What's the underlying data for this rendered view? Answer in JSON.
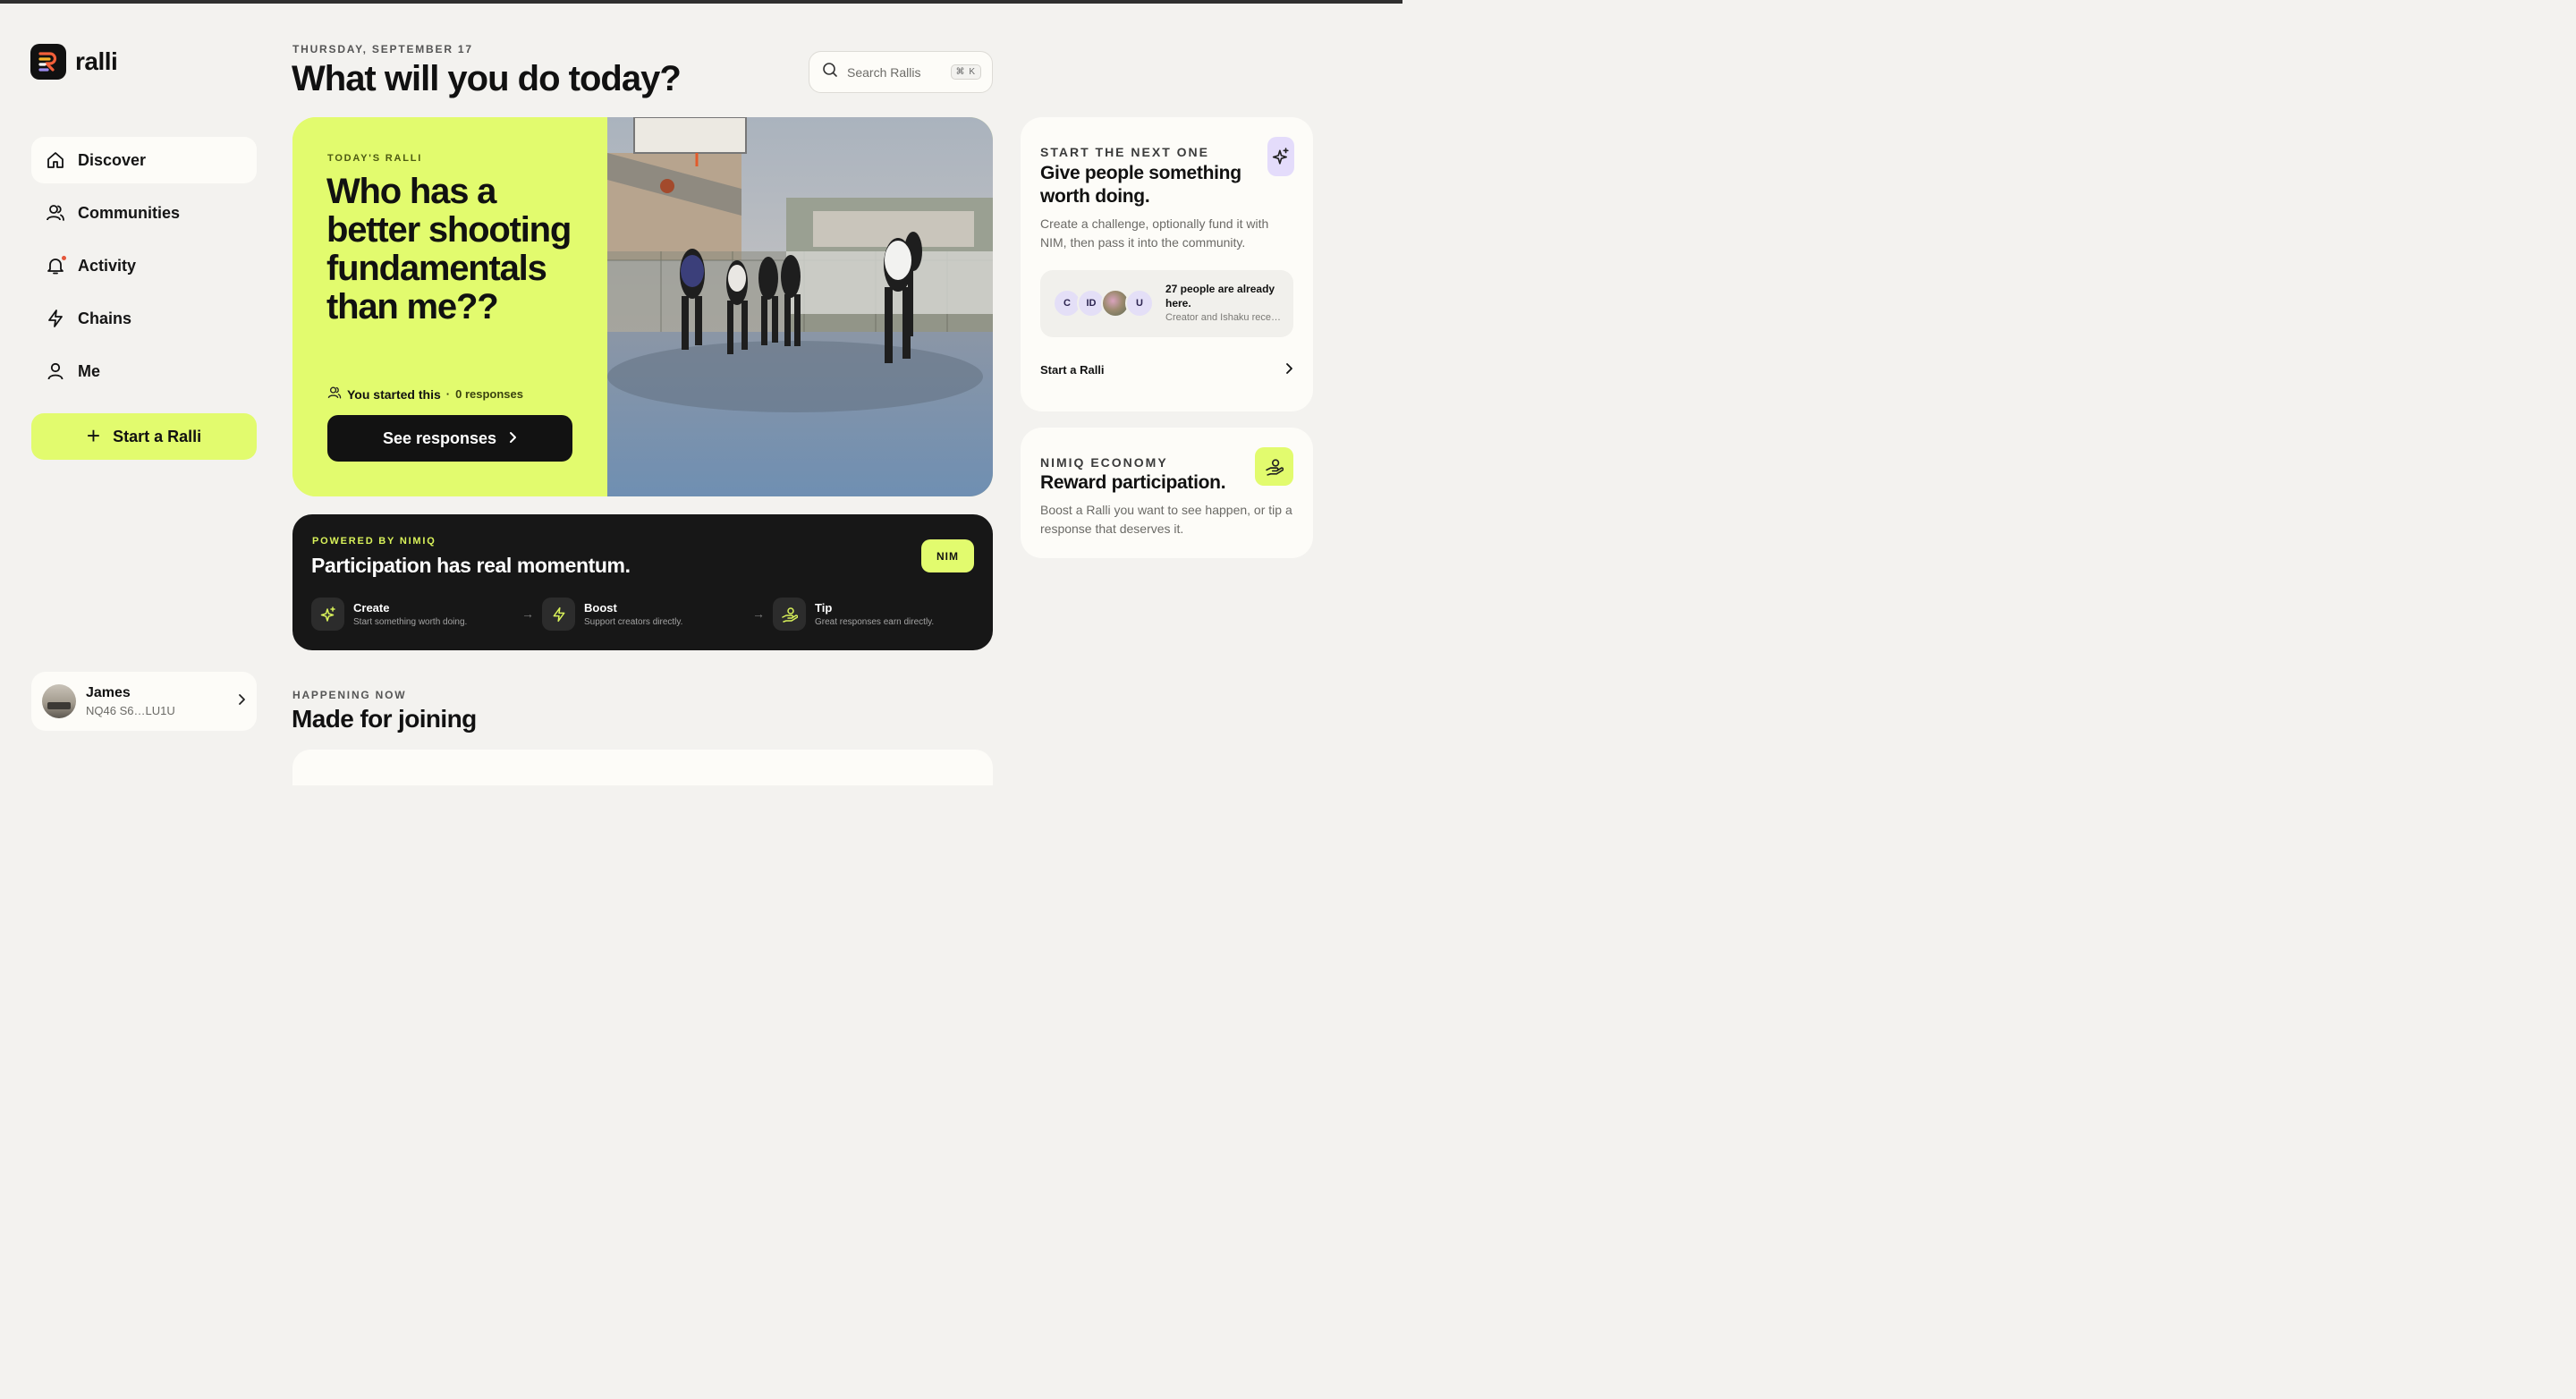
{
  "app": {
    "name": "ralli"
  },
  "sidebar": {
    "items": [
      {
        "label": "Discover",
        "icon": "home-icon",
        "active": true
      },
      {
        "label": "Communities",
        "icon": "users-icon"
      },
      {
        "label": "Activity",
        "icon": "bell-icon"
      },
      {
        "label": "Chains",
        "icon": "bolt-icon"
      },
      {
        "label": "Me",
        "icon": "user-icon"
      }
    ],
    "start_label": "Start a Ralli",
    "user": {
      "name": "James",
      "address": "NQ46 S6…LU1U"
    }
  },
  "header": {
    "date": "THURSDAY, SEPTEMBER 17",
    "headline": "What will you do today?",
    "search": {
      "placeholder": "Search Rallis",
      "shortcut": "⌘ K"
    }
  },
  "hero": {
    "kicker": "TODAY'S RALLI",
    "title": "Who has a better shooting fundamentals than me??",
    "started": "You started this",
    "separator": "·",
    "responses": "0 responses",
    "button": "See responses"
  },
  "nimiq": {
    "kicker": "POWERED BY NIMIQ",
    "title": "Participation has real momentum.",
    "badge": "NIM",
    "steps": [
      {
        "title": "Create",
        "desc": "Start something worth doing.",
        "icon": "sparkle-icon"
      },
      {
        "title": "Boost",
        "desc": "Support creators directly.",
        "icon": "bolt-icon"
      },
      {
        "title": "Tip",
        "desc": "Great responses earn directly.",
        "icon": "tip-hand-icon"
      }
    ]
  },
  "happening": {
    "kicker": "HAPPENING NOW",
    "title": "Made for joining"
  },
  "next_card": {
    "kicker": "START THE NEXT ONE",
    "title": "Give people something worth doing.",
    "desc": "Create a challenge, optionally fund it with NIM, then pass it into the community.",
    "avatars": [
      "C",
      "ID",
      "",
      "U"
    ],
    "people_title": "27 people are already here.",
    "people_sub": "Creator and Ishaku rece…",
    "link": "Start a Ralli"
  },
  "economy_card": {
    "kicker": "NIMIQ ECONOMY",
    "title": "Reward participation.",
    "desc": "Boost a Ralli you want to see happen, or tip a response that deserves it."
  },
  "colors": {
    "accent": "#e2fb6e",
    "dark": "#171717",
    "background": "#f3f2ef",
    "card": "#fdfcf8"
  }
}
